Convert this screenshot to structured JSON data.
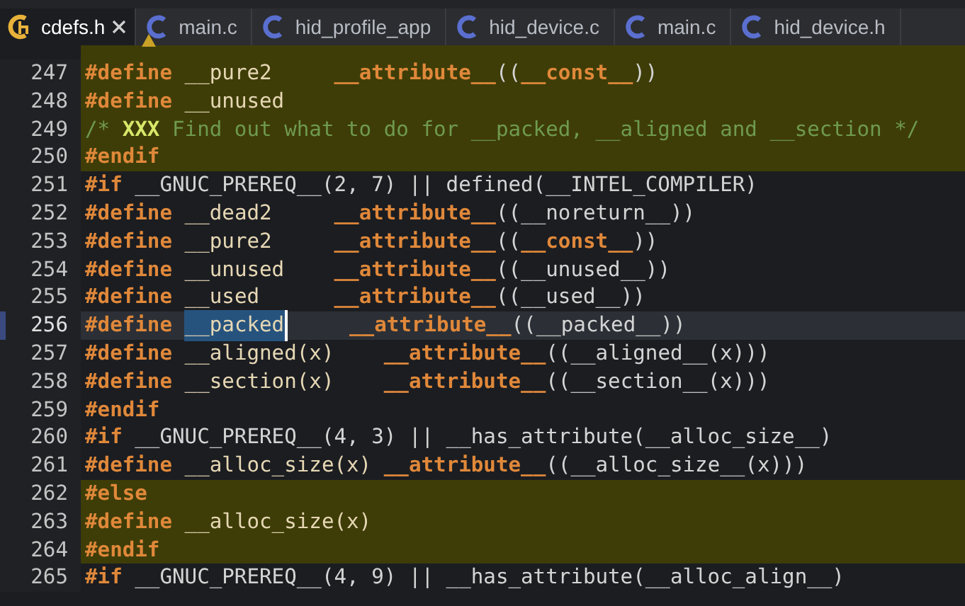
{
  "tabs": [
    {
      "label": "cdefs.h",
      "selected": true,
      "kind": "header",
      "warning": false
    },
    {
      "label": "main.c",
      "selected": false,
      "kind": "source",
      "warning": true
    },
    {
      "label": "hid_profile_app",
      "selected": false,
      "kind": "source",
      "warning": false
    },
    {
      "label": "hid_device.c",
      "selected": false,
      "kind": "source",
      "warning": false
    },
    {
      "label": "main.c",
      "selected": false,
      "kind": "source",
      "warning": false
    },
    {
      "label": "hid_device.h",
      "selected": false,
      "kind": "source",
      "warning": false
    }
  ],
  "editor": {
    "top_cut_highlighted": true,
    "lines": [
      {
        "number": "247",
        "inactive": true,
        "current": false,
        "tokens": [
          {
            "kind": "directive",
            "text": "#define"
          },
          {
            "kind": "macro",
            "text": " __pure2     "
          },
          {
            "kind": "keyword",
            "text": "__attribute__"
          },
          {
            "kind": "plain",
            "text": "(("
          },
          {
            "kind": "keyword",
            "text": "__const__"
          },
          {
            "kind": "plain",
            "text": "))"
          }
        ]
      },
      {
        "number": "248",
        "inactive": true,
        "current": false,
        "tokens": [
          {
            "kind": "directive",
            "text": "#define"
          },
          {
            "kind": "macro",
            "text": " __unused"
          }
        ]
      },
      {
        "number": "249",
        "inactive": true,
        "current": false,
        "tokens": [
          {
            "kind": "comment",
            "text": "/* "
          },
          {
            "kind": "todo",
            "text": "XXX"
          },
          {
            "kind": "comment",
            "text": " Find out what to do for __packed, __aligned and __section */"
          }
        ]
      },
      {
        "number": "250",
        "inactive": true,
        "current": false,
        "tokens": [
          {
            "kind": "directive",
            "text": "#endif"
          }
        ]
      },
      {
        "number": "251",
        "inactive": false,
        "current": false,
        "tokens": [
          {
            "kind": "directive",
            "text": "#if"
          },
          {
            "kind": "plain",
            "text": " __GNUC_PREREQ__(2, 7) || defined(__INTEL_COMPILER)"
          }
        ]
      },
      {
        "number": "252",
        "inactive": false,
        "current": false,
        "tokens": [
          {
            "kind": "directive",
            "text": "#define"
          },
          {
            "kind": "macro",
            "text": " __dead2     "
          },
          {
            "kind": "keyword",
            "text": "__attribute__"
          },
          {
            "kind": "plain",
            "text": "((__noreturn__))"
          }
        ]
      },
      {
        "number": "253",
        "inactive": false,
        "current": false,
        "tokens": [
          {
            "kind": "directive",
            "text": "#define"
          },
          {
            "kind": "macro",
            "text": " __pure2     "
          },
          {
            "kind": "keyword",
            "text": "__attribute__"
          },
          {
            "kind": "plain",
            "text": "(("
          },
          {
            "kind": "keyword",
            "text": "__const__"
          },
          {
            "kind": "plain",
            "text": "))"
          }
        ]
      },
      {
        "number": "254",
        "inactive": false,
        "current": false,
        "tokens": [
          {
            "kind": "directive",
            "text": "#define"
          },
          {
            "kind": "macro",
            "text": " __unused    "
          },
          {
            "kind": "keyword",
            "text": "__attribute__"
          },
          {
            "kind": "plain",
            "text": "((__unused__))"
          }
        ]
      },
      {
        "number": "255",
        "inactive": false,
        "current": false,
        "tokens": [
          {
            "kind": "directive",
            "text": "#define"
          },
          {
            "kind": "macro",
            "text": " __used      "
          },
          {
            "kind": "keyword",
            "text": "__attribute__"
          },
          {
            "kind": "plain",
            "text": "((__used__))"
          }
        ]
      },
      {
        "number": "256",
        "inactive": false,
        "current": true,
        "tokens": [
          {
            "kind": "directive",
            "text": "#define "
          },
          {
            "kind": "selected",
            "text": "__packed"
          },
          {
            "kind": "keyword",
            "text": "     __attribute__"
          },
          {
            "kind": "plain",
            "text": "((__packed__))"
          }
        ]
      },
      {
        "number": "257",
        "inactive": false,
        "current": false,
        "tokens": [
          {
            "kind": "directive",
            "text": "#define"
          },
          {
            "kind": "macro",
            "text": " __aligned(x)    "
          },
          {
            "kind": "keyword",
            "text": "__attribute__"
          },
          {
            "kind": "plain",
            "text": "((__aligned__(x)))"
          }
        ]
      },
      {
        "number": "258",
        "inactive": false,
        "current": false,
        "tokens": [
          {
            "kind": "directive",
            "text": "#define"
          },
          {
            "kind": "macro",
            "text": " __section(x)    "
          },
          {
            "kind": "keyword",
            "text": "__attribute__"
          },
          {
            "kind": "plain",
            "text": "((__section__(x)))"
          }
        ]
      },
      {
        "number": "259",
        "inactive": false,
        "current": false,
        "tokens": [
          {
            "kind": "directive",
            "text": "#endif"
          }
        ]
      },
      {
        "number": "260",
        "inactive": false,
        "current": false,
        "tokens": [
          {
            "kind": "directive",
            "text": "#if"
          },
          {
            "kind": "plain",
            "text": " __GNUC_PREREQ__(4, 3) || __has_attribute(__alloc_size__)"
          }
        ]
      },
      {
        "number": "261",
        "inactive": false,
        "current": false,
        "tokens": [
          {
            "kind": "directive",
            "text": "#define"
          },
          {
            "kind": "macro",
            "text": " __alloc_size(x) "
          },
          {
            "kind": "keyword",
            "text": "__attribute__"
          },
          {
            "kind": "plain",
            "text": "((__alloc_size__(x)))"
          }
        ]
      },
      {
        "number": "262",
        "inactive": true,
        "current": false,
        "tokens": [
          {
            "kind": "directive",
            "text": "#else"
          }
        ]
      },
      {
        "number": "263",
        "inactive": true,
        "current": false,
        "tokens": [
          {
            "kind": "directive",
            "text": "#define"
          },
          {
            "kind": "macro",
            "text": " __alloc_size(x)"
          }
        ]
      },
      {
        "number": "264",
        "inactive": true,
        "current": false,
        "tokens": [
          {
            "kind": "directive",
            "text": "#endif"
          }
        ]
      },
      {
        "number": "265",
        "inactive": false,
        "current": false,
        "tokens": [
          {
            "kind": "directive",
            "text": "#if"
          },
          {
            "kind": "plain",
            "text": " __GNUC_PREREQ__(4, 9) || __has_attribute(__alloc_align__)"
          }
        ]
      }
    ]
  }
}
